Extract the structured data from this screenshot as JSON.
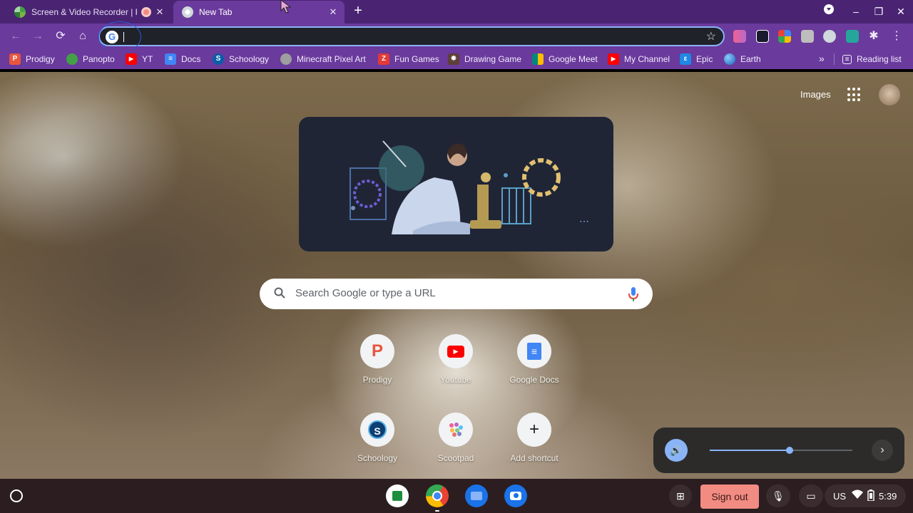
{
  "tabs": [
    {
      "title": "Screen & Video Recorder | Panopto",
      "active": false
    },
    {
      "title": "New Tab",
      "active": true
    }
  ],
  "bookmarks": [
    {
      "label": "Prodigy",
      "icon": "prodigy-icon",
      "color": "#e8553f"
    },
    {
      "label": "Panopto",
      "icon": "panopto-icon",
      "color": "#43a047"
    },
    {
      "label": "YT",
      "icon": "youtube-icon",
      "color": "#ff0000"
    },
    {
      "label": "Docs",
      "icon": "docs-icon",
      "color": "#4285f4"
    },
    {
      "label": "Schoology",
      "icon": "schoology-icon",
      "color": "#0a5da8"
    },
    {
      "label": "Minecraft Pixel Art",
      "icon": "minecraft-icon",
      "color": "#9e9e9e"
    },
    {
      "label": "Fun Games",
      "icon": "fun-games-icon",
      "color": "#e53935"
    },
    {
      "label": "Drawing Game",
      "icon": "drawing-game-icon",
      "color": "#b8860b"
    },
    {
      "label": "Google Meet",
      "icon": "google-meet-icon",
      "color": "#00897b"
    },
    {
      "label": "My Channel",
      "icon": "youtube-icon",
      "color": "#ff0000"
    },
    {
      "label": "Epic",
      "icon": "epic-icon",
      "color": "#1e88e5"
    },
    {
      "label": "Earth",
      "icon": "earth-icon",
      "color": "#42a5f5"
    }
  ],
  "reading_list": "Reading list",
  "bookmarks_overflow": "»",
  "omnibox": {
    "value": ""
  },
  "ntp": {
    "images_link": "Images",
    "search_placeholder": "Search Google or type a URL",
    "shortcuts": [
      {
        "label": "Prodigy",
        "icon": "prodigy-icon"
      },
      {
        "label": "Youtube",
        "icon": "youtube-icon"
      },
      {
        "label": "Google Docs",
        "icon": "docs-icon"
      },
      {
        "label": "Schoology",
        "icon": "schoology-icon"
      },
      {
        "label": "Scootpad",
        "icon": "scootpad-icon"
      },
      {
        "label": "Add shortcut",
        "icon": "plus-icon"
      }
    ]
  },
  "volume": {
    "level": 0.56
  },
  "shelf": {
    "signout_label": "Sign out",
    "ime": "US",
    "time": "5:39"
  },
  "colors": {
    "theme_frame": "#4a2473",
    "theme_toolbar": "#6a3a9c",
    "accent": "#8ab4f8",
    "signout": "#f28b82"
  }
}
